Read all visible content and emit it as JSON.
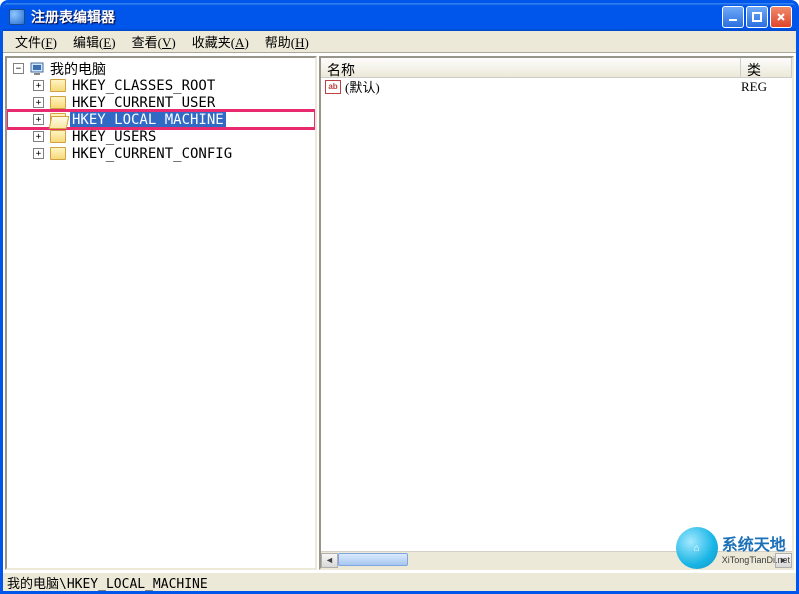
{
  "window": {
    "title": "注册表编辑器"
  },
  "menu": {
    "file": {
      "label": "文件",
      "hotkey": "F"
    },
    "edit": {
      "label": "编辑",
      "hotkey": "E"
    },
    "view": {
      "label": "查看",
      "hotkey": "V"
    },
    "favorites": {
      "label": "收藏夹",
      "hotkey": "A"
    },
    "help": {
      "label": "帮助",
      "hotkey": "H"
    }
  },
  "tree": {
    "root": {
      "label": "我的电脑",
      "expanded": true,
      "icon": "computer"
    },
    "items": [
      {
        "label": "HKEY_CLASSES_ROOT",
        "expandable": true
      },
      {
        "label": "HKEY_CURRENT_USER",
        "expandable": true
      },
      {
        "label": "HKEY_LOCAL_MACHINE",
        "expandable": true,
        "selected": true,
        "highlighted": true
      },
      {
        "label": "HKEY_USERS",
        "expandable": true
      },
      {
        "label": "HKEY_CURRENT_CONFIG",
        "expandable": true
      }
    ]
  },
  "list": {
    "columns": {
      "name": "名称",
      "type": "类"
    },
    "rows": [
      {
        "icon": "ab",
        "name": "(默认)",
        "type": "REG"
      }
    ]
  },
  "statusbar": {
    "path": "我的电脑\\HKEY_LOCAL_MACHINE"
  },
  "watermark": {
    "cn": "系统天地",
    "en": "XiTongTianDi.net"
  }
}
